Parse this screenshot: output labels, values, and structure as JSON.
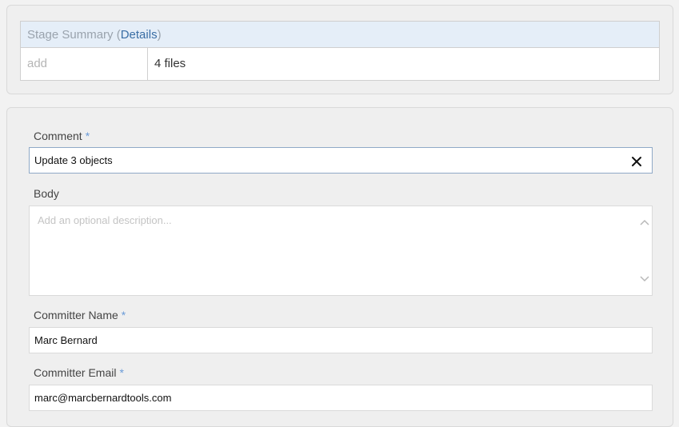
{
  "summary": {
    "header_prefix": "Stage Summary (",
    "details_link": "Details",
    "header_suffix": ")",
    "row": {
      "key": "add",
      "value": "4 files"
    }
  },
  "form": {
    "comment": {
      "label": "Comment",
      "required_mark": "*",
      "value": "Update 3 objects",
      "clear_icon": "close-icon"
    },
    "body": {
      "label": "Body",
      "placeholder": "Add an optional description..."
    },
    "committer_name": {
      "label": "Committer Name",
      "required_mark": "*",
      "value": "Marc Bernard"
    },
    "committer_email": {
      "label": "Committer Email",
      "required_mark": "*",
      "value": "marc@marcbernardtools.com"
    }
  },
  "colors": {
    "header_bg": "#e5eef8",
    "link": "#3a6ea5",
    "required": "#6a9bd8"
  }
}
